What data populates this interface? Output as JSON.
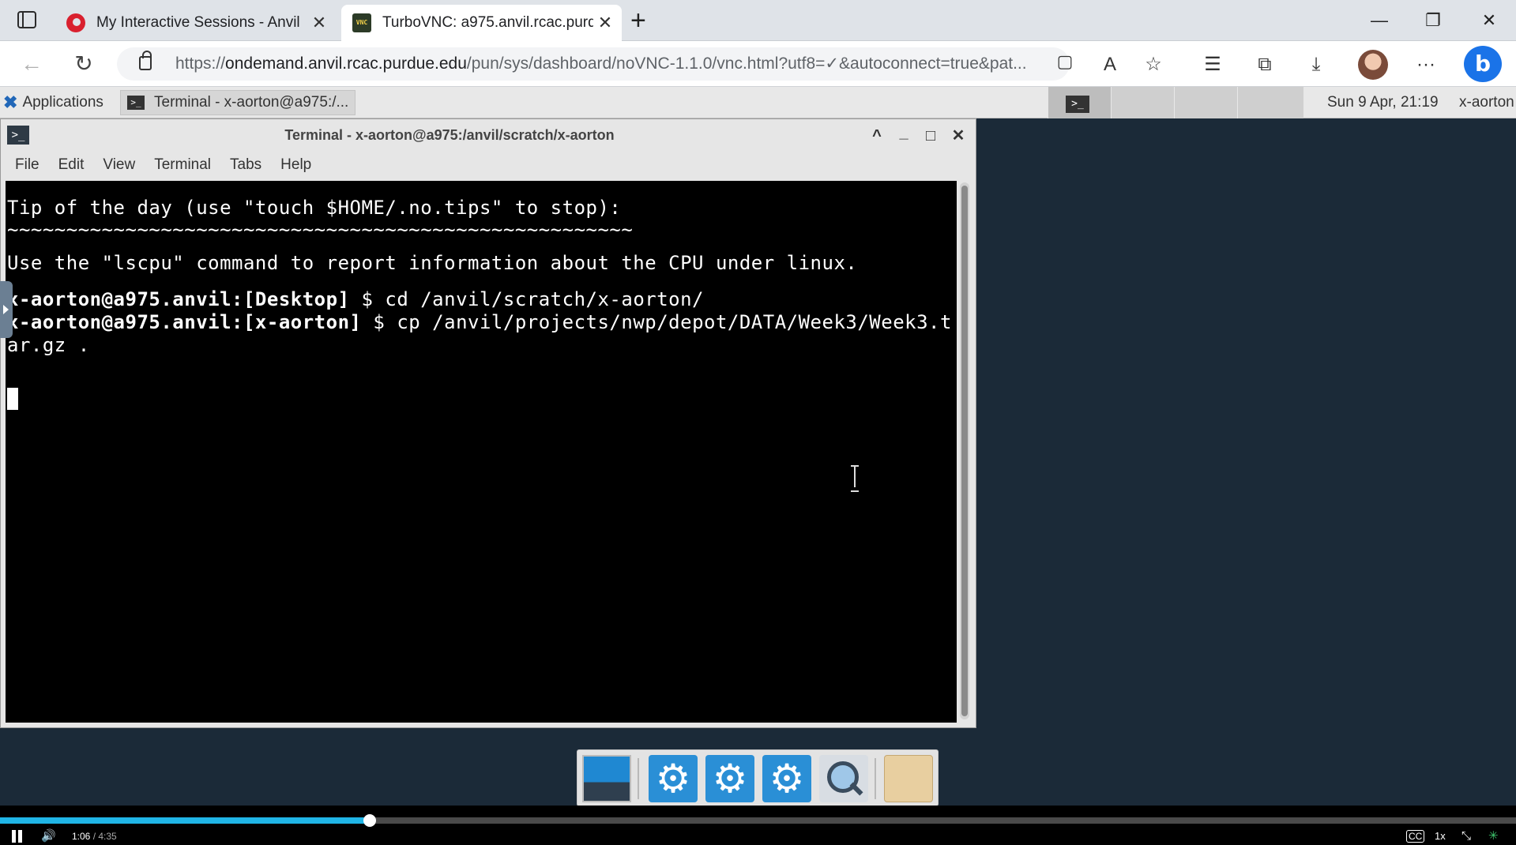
{
  "browser": {
    "tabs": [
      {
        "title": "My Interactive Sessions - Anvil",
        "favicon": "anvil-logo-icon",
        "active": false
      },
      {
        "title": "TurboVNC: a975.anvil.rcac.purdue",
        "favicon": "vnc-icon",
        "active": true
      }
    ],
    "favicon_vnc_text": "VNC",
    "close_glyph": "✕",
    "new_tab_glyph": "+",
    "window_controls": {
      "minimize": "—",
      "restore": "❐",
      "close": "✕"
    },
    "nav": {
      "back": "←",
      "reload": "↻"
    },
    "url": {
      "scheme": "https://",
      "host": "ondemand.anvil.rcac.purdue.edu",
      "path": "/pun/sys/dashboard/noVNC-1.1.0/vnc.html?utf8=✓&autoconnect=true&pat..."
    },
    "toolbar_icons": {
      "clipboard": "▢",
      "read_aloud": "A",
      "add_favorite": "☆",
      "favorites": "☰",
      "collections": "⧉",
      "downloads": "⤓",
      "more": "···",
      "bing": "b"
    }
  },
  "desktop": {
    "panel": {
      "applications_label": "Applications",
      "applications_icon_glyph": "✖",
      "task_label": "Terminal - x-aorton@a975:/...",
      "clock": "Sun  9 Apr, 21:19",
      "user": "x-aorton"
    },
    "terminal": {
      "title": "Terminal - x-aorton@a975:/anvil/scratch/x-aorton",
      "icon_glyph": ">_",
      "controls": {
        "shade": "^",
        "minimize": "_",
        "maximize": "□",
        "close": "✕"
      },
      "menu": [
        "File",
        "Edit",
        "View",
        "Terminal",
        "Tabs",
        "Help"
      ],
      "lines": [
        {
          "prompt": "",
          "text": "Tip of the day (use \"touch $HOME/.no.tips\" to stop):"
        },
        {
          "prompt": "",
          "text": "~~~~~~~~~~~~~~~~~~~~~~~~~~~~~~~~~~~~~~~~~~~~~~~~~~~~~"
        },
        {
          "prompt": "",
          "text": ""
        },
        {
          "prompt": "",
          "text": "Use the \"lscpu\" command to report information about the CPU under linux."
        },
        {
          "prompt": "",
          "text": ""
        },
        {
          "prompt": "x-aorton@a975.anvil:[Desktop]",
          "text": " $ cd /anvil/scratch/x-aorton/"
        },
        {
          "prompt": "x-aorton@a975.anvil:[x-aorton]",
          "text": " $ cp /anvil/projects/nwp/depot/DATA/Week3/Week3.t"
        },
        {
          "prompt": "",
          "text": "ar.gz ."
        }
      ]
    },
    "dock": {
      "items": [
        "desktop-icon",
        "settings-icon",
        "settings-icon",
        "settings-icon",
        "search-icon",
        "folder-icon"
      ],
      "gear_glyph": "⚙"
    }
  },
  "video": {
    "progress": 0.244,
    "current_time": "1:06",
    "duration": "/ 4:35",
    "speed": "1x",
    "captions_label": "CC",
    "volume_glyph": "🔊",
    "shrink_glyph": "⤡",
    "spinner_glyph": "✳"
  }
}
